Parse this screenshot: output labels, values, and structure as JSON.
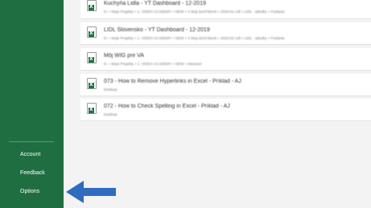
{
  "sidebar": {
    "items": [
      {
        "label": "Account"
      },
      {
        "label": "Feedback"
      },
      {
        "label": "Options"
      }
    ]
  },
  "recent_files": [
    {
      "name": "Kuchyňa Lidla - YT Dashboard - 12-2019",
      "path": "D: » Moje Projekty » 1. VIDEO ACADEMY » NEW » 4 Moji doctl klienti » 2018-02 Lidl » LIDL - tabulky » Poslanie"
    },
    {
      "name": "LIDL Slovensko - YT Dashboard - 12-2019",
      "path": "D: » Moje Projekty » 1. VIDEO ACADEMY » NEW » 4 Moji doctl klienti » 2018-02 Lidl » LIDL - tabulky » Poslanie"
    },
    {
      "name": "Môj WIG pre VA",
      "path": "D: » Moje Projekty » 1. VIDEO ACADEMY » NEW » Manazer"
    },
    {
      "name": "073 - How to Remove Hyperlinks in Excel - Príklad - AJ",
      "path": "Desktop"
    },
    {
      "name": "072 - How to Check Spelling in Excel - Príklad - AJ",
      "path": "Desktop"
    }
  ],
  "colors": {
    "sidebar": "#1e6e42",
    "arrow": "#2f6bbf"
  }
}
